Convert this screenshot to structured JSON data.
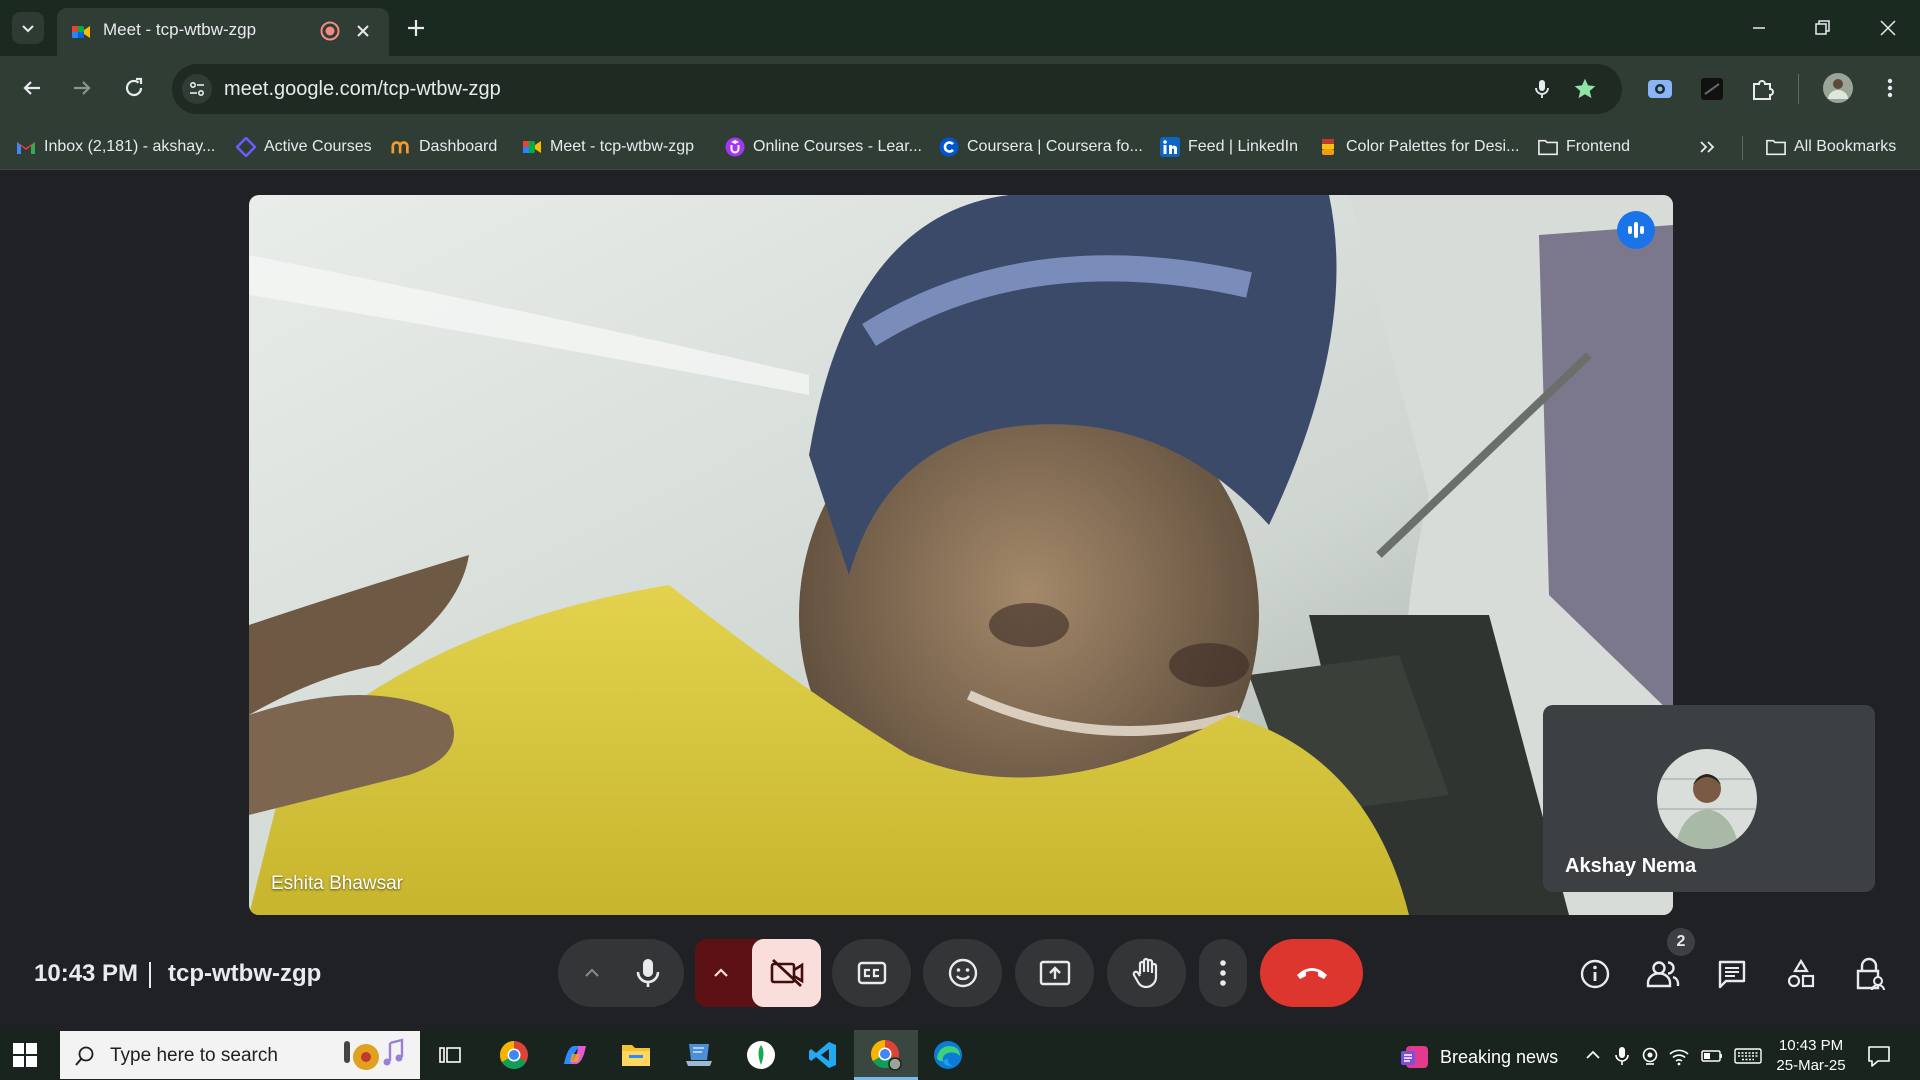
{
  "browser": {
    "tab": {
      "title": "Meet - tcp-wtbw-zgp"
    },
    "url": "meet.google.com/tcp-wtbw-zgp",
    "bookmarks": [
      {
        "label": "Inbox (2,181) - akshay...",
        "icon": "gmail-icon"
      },
      {
        "label": "Active Courses",
        "icon": "course-diamond-icon"
      },
      {
        "label": "Dashboard",
        "icon": "dashboard-logo-icon"
      },
      {
        "label": "Meet - tcp-wtbw-zgp",
        "icon": "google-meet-icon"
      },
      {
        "label": "Online Courses - Lear...",
        "icon": "udemy-icon"
      },
      {
        "label": "Coursera | Coursera fo...",
        "icon": "coursera-icon"
      },
      {
        "label": "Feed | LinkedIn",
        "icon": "linkedin-icon"
      },
      {
        "label": "Color Palettes for Desi...",
        "icon": "palette-icon"
      },
      {
        "label": "Frontend",
        "icon": "folder-icon"
      }
    ],
    "all_bookmarks_label": "All Bookmarks"
  },
  "meet": {
    "main_participant": "Eshita Bhawsar",
    "self_participant": "Akshay Nema",
    "time": "10:43 PM",
    "meeting_code": "tcp-wtbw-zgp",
    "participant_count": "2"
  },
  "taskbar": {
    "search_placeholder": "Type here to search",
    "news": "Breaking news",
    "time": "10:43 PM",
    "date": "25-Mar-25"
  },
  "colors": {
    "chrome_frame": "#1b2a21",
    "chrome_toolbar": "#2f3d34",
    "meet_bg": "#202124",
    "leave_red": "#dc362e",
    "cam_off_bg": "#f9dedc",
    "cam_off_group": "#5c1214",
    "speaking_blue": "#1a73e8"
  }
}
